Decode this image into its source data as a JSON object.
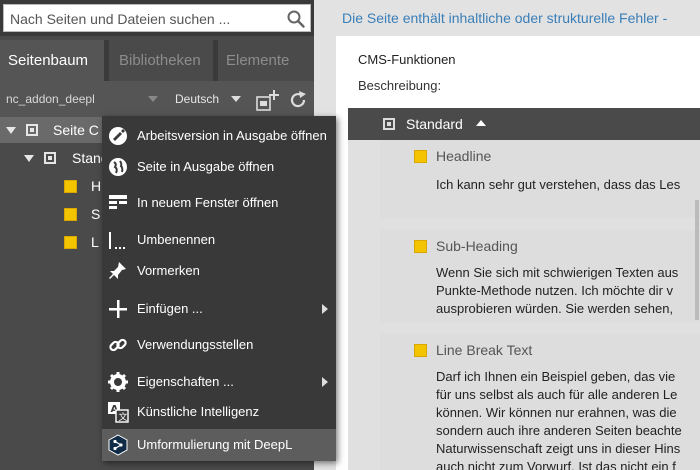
{
  "search": {
    "placeholder": "Nach Seiten und Dateien suchen ..."
  },
  "tabs": [
    {
      "label": "Seitenbaum",
      "active": true
    },
    {
      "label": "Bibliotheken",
      "active": false
    },
    {
      "label": "Elemente",
      "active": false
    }
  ],
  "toolbar": {
    "project": "nc_addon_deepl",
    "language": "Deutsch"
  },
  "tree": {
    "root": "Seite C",
    "child": "Stand",
    "items": [
      "H",
      "S",
      "L"
    ]
  },
  "context_menu": {
    "items": [
      {
        "label": "Arbeitsversion in Ausgabe öffnen",
        "icon": "open-working-version-icon"
      },
      {
        "label": "Seite in Ausgabe öffnen",
        "icon": "globe-icon"
      },
      {
        "label": "In neuem Fenster öffnen",
        "icon": "new-window-icon"
      },
      {
        "label": "Umbenennen",
        "icon": "rename-icon"
      },
      {
        "label": "Vormerken",
        "icon": "pin-icon"
      },
      {
        "label": "Einfügen ...",
        "icon": "plus-icon",
        "submenu": true
      },
      {
        "label": "Verwendungsstellen",
        "icon": "link-icon"
      },
      {
        "label": "Eigenschaften ...",
        "icon": "gear-icon",
        "submenu": true
      },
      {
        "label": "Künstliche Intelligenz",
        "icon": "translate-icon"
      },
      {
        "label": "Umformulierung mit DeepL",
        "icon": "deepl-icon",
        "highlighted": true
      }
    ]
  },
  "right": {
    "banner": "Die Seite enthält inhaltliche oder strukturelle Fehler - ",
    "cms_title": "CMS-Funktionen",
    "description_label": "Beschreibung:",
    "slice_header": "Standard",
    "blocks": [
      {
        "title": "Headline",
        "lines": [
          "Ich kann sehr gut verstehen, dass das Les"
        ]
      },
      {
        "title": "Sub-Heading",
        "lines": [
          "Wenn Sie sich mit schwierigen Texten aus",
          "Punkte-Methode nutzen. Ich möchte dir v",
          "ausprobieren würden. Sie werden sehen,"
        ]
      },
      {
        "title": "Line Break Text",
        "lines": [
          "Darf ich Ihnen ein Beispiel geben, das vie",
          "für uns selbst als auch für alle anderen Le",
          "können. Wir können nur erahnen, was die",
          "sondern auch ihre anderen Seiten beachte",
          "Naturwissenschaft zeigt uns in dieser Hins",
          "auch nicht zum Vorwurf. Ist das nicht ein f"
        ]
      }
    ]
  },
  "colors": {
    "accent_yellow": "#f5c400",
    "banner_link": "#3a7fb8",
    "menu_bg": "#393939",
    "menu_highlight": "#5d5d5d"
  }
}
